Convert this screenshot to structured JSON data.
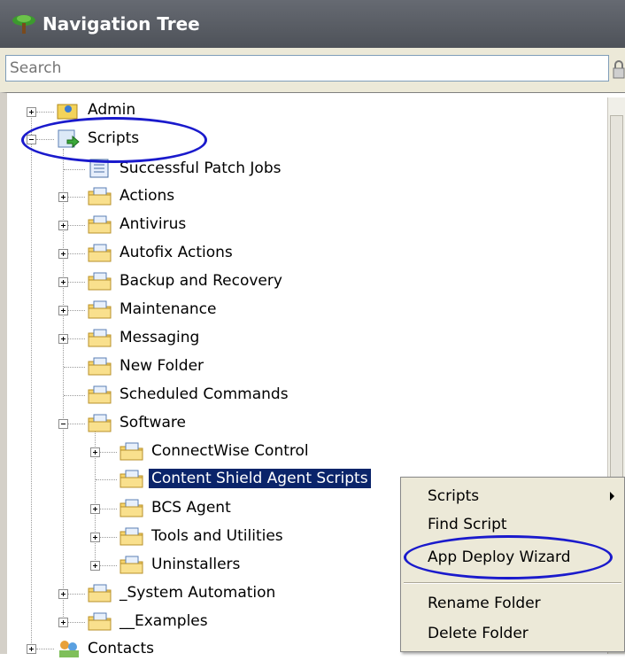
{
  "window": {
    "title": "Navigation Tree",
    "title_icon": "tree-icon"
  },
  "search": {
    "placeholder": "Search"
  },
  "tree": {
    "root_items": [
      {
        "label": "Admin",
        "icon": "admin-icon",
        "expander": "plus"
      },
      {
        "label": "Scripts",
        "icon": "scripts-icon",
        "expander": "minus",
        "highlighted": true
      },
      {
        "label": "Contacts",
        "icon": "contacts-icon",
        "expander": "plus"
      }
    ],
    "scripts_children": [
      {
        "label": "Successful Patch Jobs",
        "icon": "report-icon",
        "expander": "none"
      },
      {
        "label": "Actions",
        "icon": "folder-icon",
        "expander": "plus"
      },
      {
        "label": "Antivirus",
        "icon": "folder-icon",
        "expander": "plus"
      },
      {
        "label": "Autofix Actions",
        "icon": "folder-icon",
        "expander": "plus"
      },
      {
        "label": "Backup and Recovery",
        "icon": "folder-icon",
        "expander": "plus"
      },
      {
        "label": "Maintenance",
        "icon": "folder-icon",
        "expander": "plus"
      },
      {
        "label": "Messaging",
        "icon": "folder-icon",
        "expander": "plus"
      },
      {
        "label": "New Folder",
        "icon": "folder-icon",
        "expander": "none"
      },
      {
        "label": "Scheduled Commands",
        "icon": "folder-icon",
        "expander": "none"
      },
      {
        "label": "Software",
        "icon": "folder-icon",
        "expander": "minus"
      },
      {
        "label": "_System Automation",
        "icon": "folder-icon",
        "expander": "plus"
      },
      {
        "label": "__Examples",
        "icon": "folder-icon",
        "expander": "plus"
      }
    ],
    "software_children": [
      {
        "label": "ConnectWise Control",
        "icon": "folder-icon",
        "expander": "plus"
      },
      {
        "label": "Content Shield Agent Scripts",
        "icon": "folder-icon",
        "expander": "none",
        "selected": true
      },
      {
        "label": "BCS Agent",
        "icon": "folder-icon",
        "expander": "plus"
      },
      {
        "label": "Tools and Utilities",
        "icon": "folder-icon",
        "expander": "plus"
      },
      {
        "label": "Uninstallers",
        "icon": "folder-icon",
        "expander": "plus"
      }
    ]
  },
  "context_menu": {
    "items": [
      {
        "label": "Scripts",
        "has_submenu": true
      },
      {
        "label": "Find Script"
      },
      {
        "label": "App Deploy Wizard",
        "highlighted": true
      },
      {
        "label": "Rename Folder"
      },
      {
        "label": "Delete Folder"
      }
    ]
  },
  "colors": {
    "selection": "#0a246a",
    "annotation": "#1a1acc",
    "title_bar": "#585c63",
    "menu_bg": "#ece9d8"
  }
}
